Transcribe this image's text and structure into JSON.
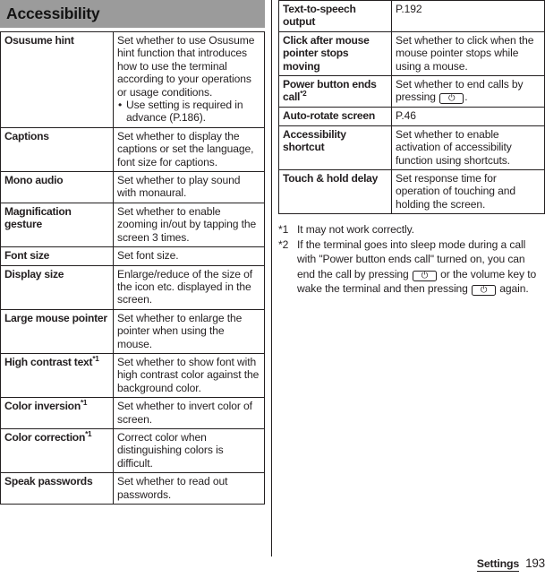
{
  "section": {
    "title": "Accessibility"
  },
  "left_table": {
    "rows": [
      {
        "term": "Osusume hint",
        "term_sup": "",
        "desc": "Set whether to use Osusume hint function that introduces how to use the terminal according to your operations or usage conditions.",
        "bullets": [
          "Use setting is required in advance (P.186)."
        ]
      },
      {
        "term": "Captions",
        "term_sup": "",
        "desc": "Set whether to display the captions or set the language, font size for captions.",
        "bullets": []
      },
      {
        "term": "Mono audio",
        "term_sup": "",
        "desc": "Set whether to play sound with monaural.",
        "bullets": []
      },
      {
        "term": "Magnification gesture",
        "term_sup": "",
        "desc": "Set whether to enable zooming in/out by tapping the screen 3 times.",
        "bullets": []
      },
      {
        "term": "Font size",
        "term_sup": "",
        "desc": "Set font size.",
        "bullets": []
      },
      {
        "term": "Display size",
        "term_sup": "",
        "desc": "Enlarge/reduce of the size of the icon etc. displayed in the screen.",
        "bullets": []
      },
      {
        "term": "Large mouse pointer",
        "term_sup": "",
        "desc": "Set whether to enlarge the pointer when using the mouse.",
        "bullets": []
      },
      {
        "term": "High contrast text",
        "term_sup": "*1",
        "desc": "Set whether to show font with high contrast color against the background color.",
        "bullets": []
      },
      {
        "term": "Color inversion",
        "term_sup": "*1",
        "desc": "Set whether to invert color of screen.",
        "bullets": []
      },
      {
        "term": "Color correction",
        "term_sup": "*1",
        "desc": "Correct color when distinguishing colors is difficult.",
        "bullets": []
      },
      {
        "term": "Speak passwords",
        "term_sup": "",
        "desc": "Set whether to read out passwords.",
        "bullets": []
      }
    ]
  },
  "right_table": {
    "rows": [
      {
        "term": "Text-to-speech output",
        "term_sup": "",
        "desc": "P.192",
        "has_keycap": false,
        "desc_after_key": ""
      },
      {
        "term": "Click after mouse pointer stops moving",
        "term_sup": "",
        "desc": "Set whether to click when the mouse pointer stops while using a mouse.",
        "has_keycap": false,
        "desc_after_key": ""
      },
      {
        "term": "Power button ends call",
        "term_sup": "*2",
        "desc": "Set whether to end calls by pressing ",
        "has_keycap": true,
        "desc_after_key": "."
      },
      {
        "term": "Auto-rotate screen",
        "term_sup": "",
        "desc": "P.46",
        "has_keycap": false,
        "desc_after_key": ""
      },
      {
        "term": "Accessibility shortcut",
        "term_sup": "",
        "desc": "Set whether to enable activation of accessibility function using shortcuts.",
        "has_keycap": false,
        "desc_after_key": ""
      },
      {
        "term": "Touch & hold delay",
        "term_sup": "",
        "desc": "Set response time for operation of touching and holding the screen.",
        "has_keycap": false,
        "desc_after_key": ""
      }
    ]
  },
  "footnotes": [
    {
      "mark": "*1",
      "text_part_1": "It may not work correctly.",
      "text_part_2": "",
      "text_part_3": "",
      "keycaps": 0
    },
    {
      "mark": "*2",
      "text_part_1": "If the terminal goes into sleep mode during a call with \"Power button ends call\" turned on, you can end the call by pressing ",
      "text_part_2": " or the volume key to wake the terminal and then pressing ",
      "text_part_3": " again.",
      "keycaps": 2
    }
  ],
  "keycap": {
    "glyph": "⏻",
    "name": "power-button-key"
  },
  "footer": {
    "chapter": "Settings",
    "page_number": "193"
  },
  "colors": {
    "section_bar": "#9b9b9b",
    "text": "#231f20",
    "rule": "#231f20"
  }
}
